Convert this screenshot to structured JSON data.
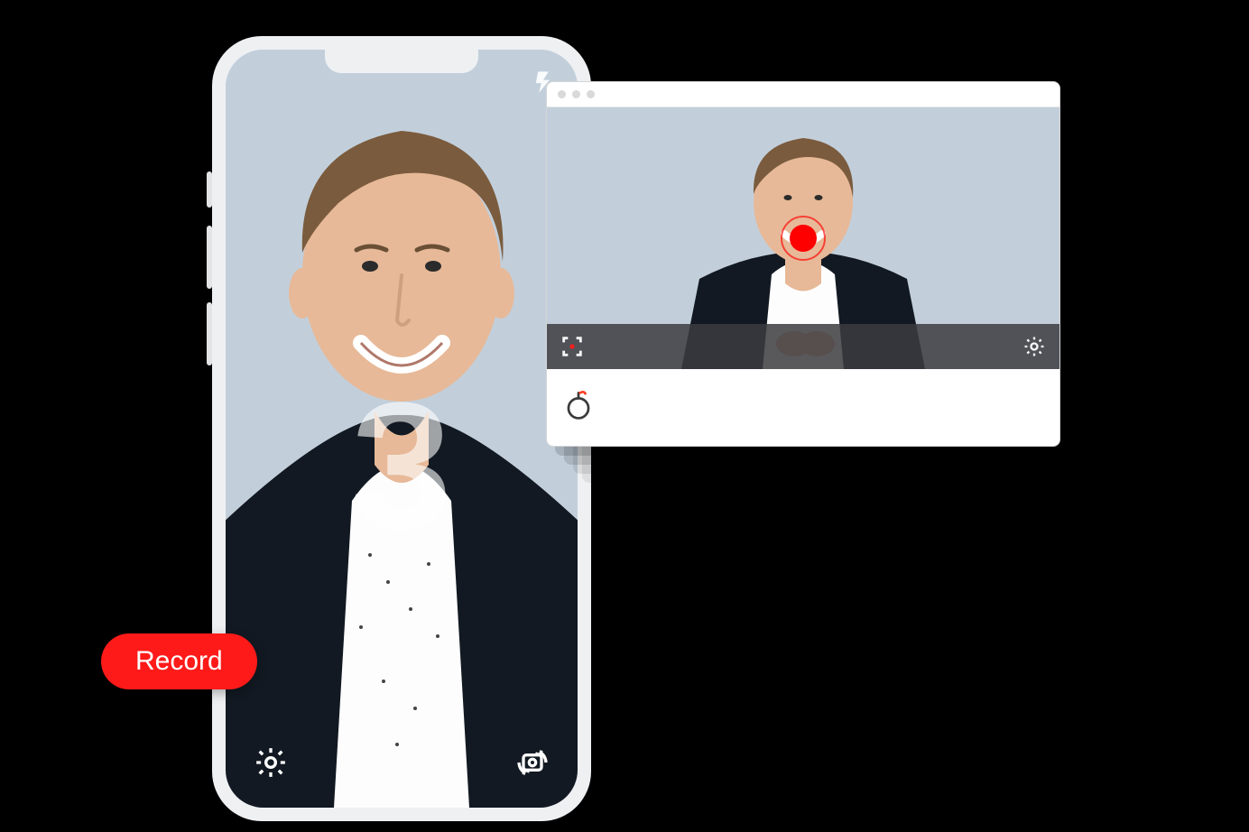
{
  "phone": {
    "countdown": "3",
    "flash_icon": "flash",
    "settings_icon": "settings",
    "camera_flip_icon": "camera-flip"
  },
  "record_button": {
    "label": "Record"
  },
  "browser": {
    "focus_icon": "focus-frame",
    "settings_icon": "settings",
    "record_indicator": "recording",
    "logo": "bombbomb-flame"
  },
  "colors": {
    "record_red": "#ff1a1a",
    "phone_bezel": "#eef0f2"
  }
}
